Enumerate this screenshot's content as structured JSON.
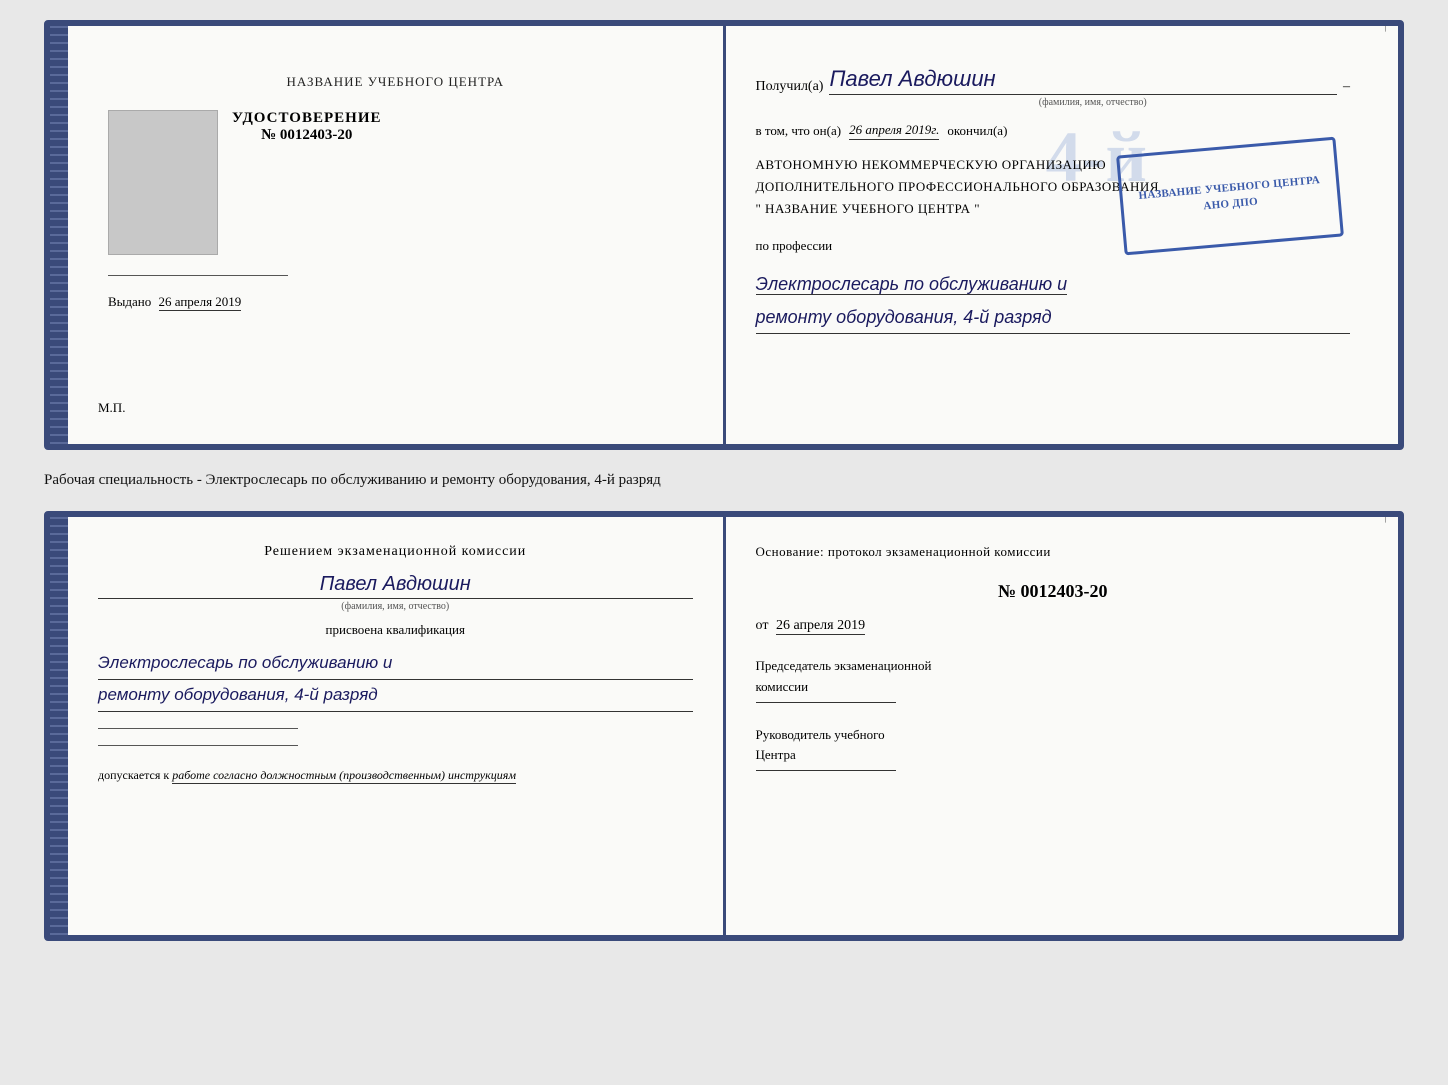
{
  "top_doc": {
    "left": {
      "center_title": "НАЗВАНИЕ УЧЕБНОГО ЦЕНТРА",
      "udostoverenie": "УДОСТОВЕРЕНИЕ",
      "number": "№ 0012403-20",
      "vydano_label": "Выдано",
      "vydano_date": "26 апреля 2019",
      "mp": "М.П."
    },
    "right": {
      "poluchil_label": "Получил(а)",
      "poluchil_name": "Павел Авдюшин",
      "fio_hint": "(фамилия, имя, отчество)",
      "vtom_label": "в том, что он(а)",
      "vtom_date": "26 апреля 2019г.",
      "okonchil_label": "окончил(а)",
      "org_line1": "АВТОНОМНУЮ НЕКОММЕРЧЕСКУЮ ОРГАНИЗАЦИЮ",
      "org_line2": "ДОПОЛНИТЕЛЬНОГО ПРОФЕССИОНАЛЬНОГО ОБРАЗОВАНИЯ",
      "org_line3": "\" НАЗВАНИЕ УЧЕБНОГО ЦЕНТРА \"",
      "po_professii": "по профессии",
      "profession_line1": "Электрослесарь по обслуживанию и",
      "profession_line2": "ремонту оборудования, 4-й разряд",
      "big_number": "4-й"
    }
  },
  "middle": {
    "text": "Рабочая специальность - Электрослесарь по обслуживанию и ремонту оборудования, 4-й разряд"
  },
  "bottom_doc": {
    "left": {
      "resheniem_line1": "Решением экзаменационной комиссии",
      "name": "Павел Авдюшин",
      "fio_hint": "(фамилия, имя, отчество)",
      "prisvoena": "присвоена квалификация",
      "qual_line1": "Электрослесарь по обслуживанию и",
      "qual_line2": "ремонту оборудования, 4-й разряд",
      "dopuskaetsya_label": "допускается к",
      "dopuskaetsya_text": "работе согласно должностным (производственным) инструкциям"
    },
    "right": {
      "osnov_label": "Основание: протокол экзаменационной комиссии",
      "osnov_num": "№ 0012403-20",
      "ot_label": "от",
      "ot_date": "26 апреля 2019",
      "chairman_line1": "Председатель экзаменационной",
      "chairman_line2": "комиссии",
      "director_line1": "Руководитель учебного",
      "director_line2": "Центра"
    }
  },
  "right_labels": [
    "и",
    "а",
    "←",
    "–",
    "–",
    "–",
    "–"
  ]
}
